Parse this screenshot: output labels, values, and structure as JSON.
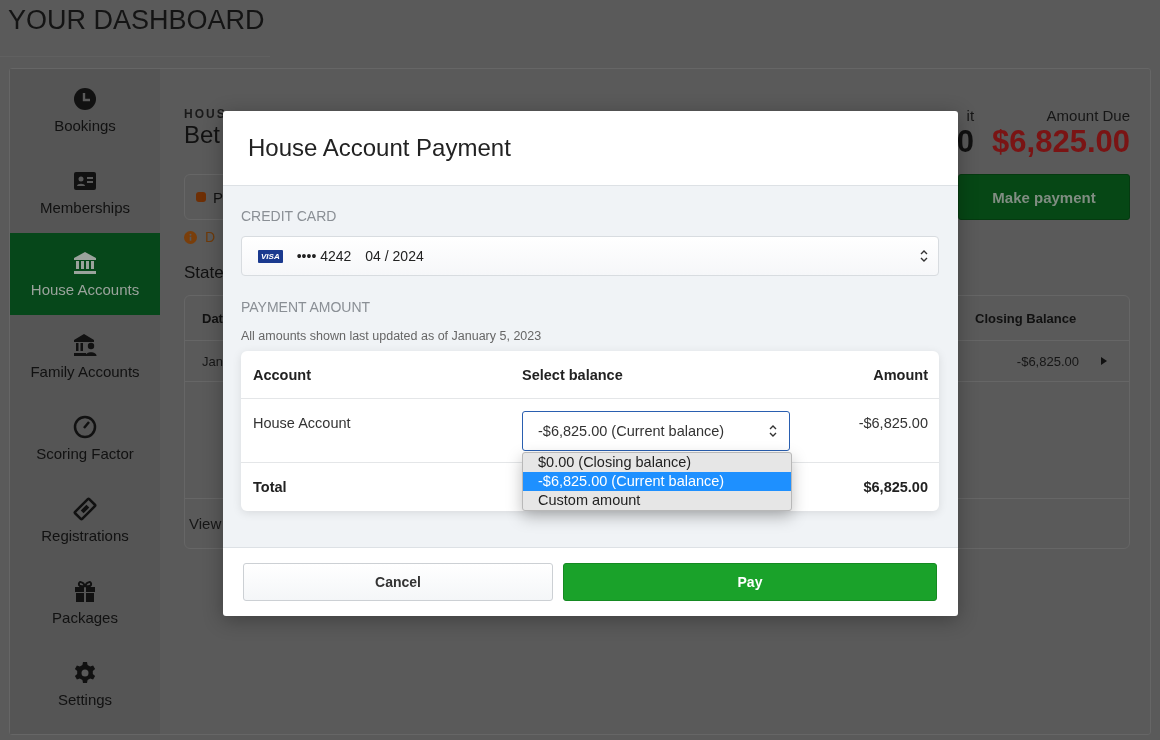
{
  "page_title": "YOUR DASHBOARD",
  "sidebar": {
    "items": [
      {
        "label": "Bookings",
        "selected": false
      },
      {
        "label": "Memberships",
        "selected": false
      },
      {
        "label": "House Accounts",
        "selected": true
      },
      {
        "label": "Family Accounts",
        "selected": false
      },
      {
        "label": "Scoring Factor",
        "selected": false
      },
      {
        "label": "Registrations",
        "selected": false
      },
      {
        "label": "Packages",
        "selected": false
      },
      {
        "label": "Settings",
        "selected": false
      }
    ]
  },
  "background": {
    "account_label": "HOUS",
    "account_name": "Bet",
    "credit_limit": {
      "label": "it",
      "value": "0"
    },
    "amount_due": {
      "label": "Amount Due",
      "value": "$6,825.00"
    },
    "status_card": {
      "text": "P"
    },
    "make_payment_button": "Make payment",
    "notice": "D",
    "statement_heading": "State",
    "table": {
      "columns": [
        "Dat",
        "Closing Balance"
      ],
      "rows": [
        {
          "date": "Jan",
          "closing_balance": "-$6,825.00"
        }
      ],
      "footer_link": "View"
    }
  },
  "modal": {
    "title": "House Account Payment",
    "credit_card_label": "CREDIT CARD",
    "card": {
      "brand": "VISA",
      "number": "•••• 4242",
      "expiry": "04 / 2024"
    },
    "payment_amount_label": "PAYMENT AMOUNT",
    "note": "All amounts shown last updated as of January 5, 2023",
    "table": {
      "columns": [
        "Account",
        "Select balance",
        "Amount"
      ],
      "rows": [
        {
          "account": "House Account",
          "balance_select": "-$6,825.00 (Current balance)",
          "amount": "-$6,825.00"
        }
      ],
      "total": {
        "label": "Total",
        "amount": "$6,825.00"
      }
    },
    "dropdown": {
      "options": [
        {
          "label": "$0.00 (Closing balance)",
          "selected": false
        },
        {
          "label": "-$6,825.00 (Current balance)",
          "selected": true
        },
        {
          "label": "Custom amount",
          "selected": false
        }
      ]
    },
    "buttons": {
      "cancel": "Cancel",
      "pay": "Pay"
    }
  }
}
